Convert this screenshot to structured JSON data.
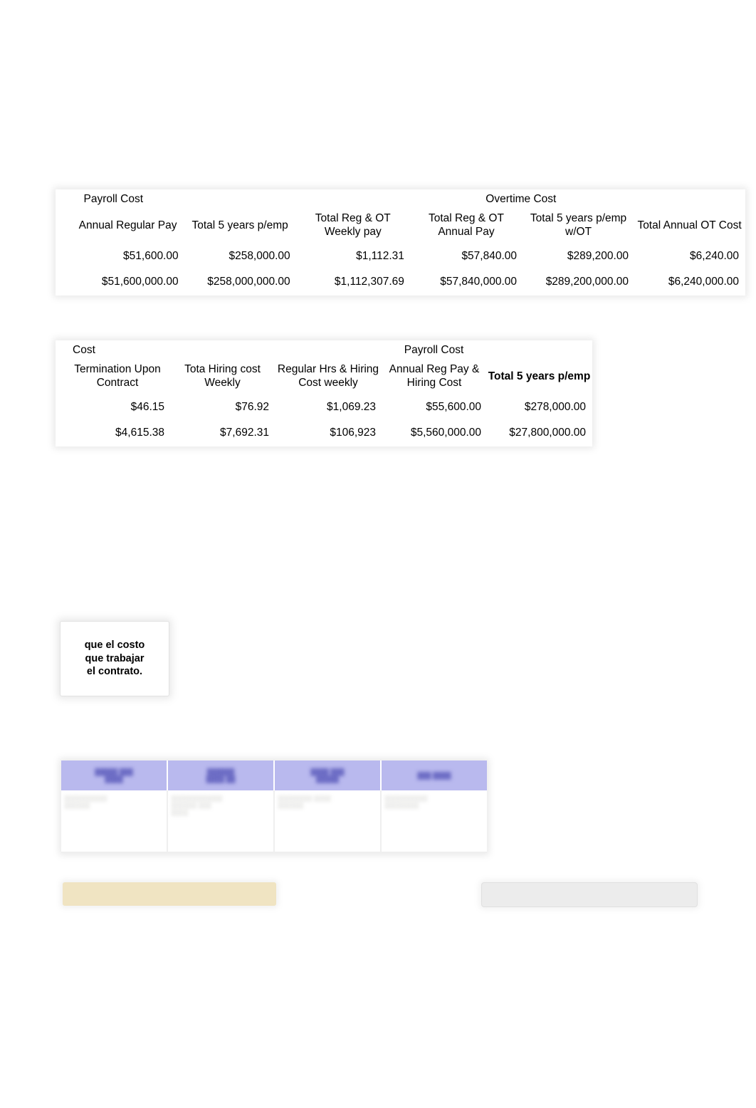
{
  "document": {
    "type": "spreadsheet-screenshot"
  },
  "table_payroll_overtime": {
    "bands": [
      {
        "label": "Payroll Cost",
        "span": 2,
        "color": "#f3e8c8"
      },
      {
        "label": "Overtime Cost",
        "span": 4,
        "color": "#ccd6e8"
      }
    ],
    "headers": [
      "Annual Regular Pay",
      "Total 5 years p/emp",
      "Total Reg & OT Weekly pay",
      "Total Reg & OT Annual Pay",
      "Total 5 years p/emp w/OT",
      "Total Annual OT Cost"
    ],
    "rows": [
      [
        "$51,600.00",
        "$258,000.00",
        "$1,112.31",
        "$57,840.00",
        "$289,200.00",
        "$6,240.00"
      ],
      [
        "$51,600,000.00",
        "$258,000,000.00",
        "$1,112,307.69",
        "$57,840,000.00",
        "$289,200,000.00",
        "$6,240,000.00"
      ]
    ]
  },
  "table_cost_payroll": {
    "bands": [
      {
        "label": "Cost",
        "span": 2,
        "color": "#efdfd2"
      },
      {
        "label": "Payroll Cost",
        "span": 3,
        "color": "#f3e8c8"
      }
    ],
    "headers": [
      "Termination Upon Contract",
      "Tota Hiring cost Weekly",
      "Regular Hrs & Hiring Cost weekly",
      "Annual Reg Pay & Hiring Cost",
      "Total 5 years p/emp"
    ],
    "header_bold": [
      false,
      false,
      false,
      false,
      true
    ],
    "rows": [
      [
        "$46.15",
        "$76.92",
        "$1,069.23",
        "$55,600.00",
        "$278,000.00"
      ],
      [
        "$4,615.38",
        "$7,692.31",
        "$106,923",
        "$5,560,000.00",
        "$27,800,000.00"
      ]
    ]
  },
  "spanish_note": {
    "text": "que el costo\nque trabajar\nel contrato."
  },
  "blurred_table": {
    "header_color": "#b9b9ee",
    "header_cells": [
      "█████ ███\n████",
      "██████\n████ ██",
      "████ ███\n█████",
      "███ ████"
    ],
    "body_cells": [
      "░░░░░░░░░░\n░░░░░░",
      "░░░░░░░░░░░░\n░░░░░░ ░░░\n░░░░",
      "░░░░░░░░ ░░░░\n░░░░░░",
      "░░░░░░░░░░\n░░░░░░░░"
    ]
  },
  "bottom_strips": {
    "left_color": "#f0e4c2",
    "right_color": "#ececec"
  }
}
